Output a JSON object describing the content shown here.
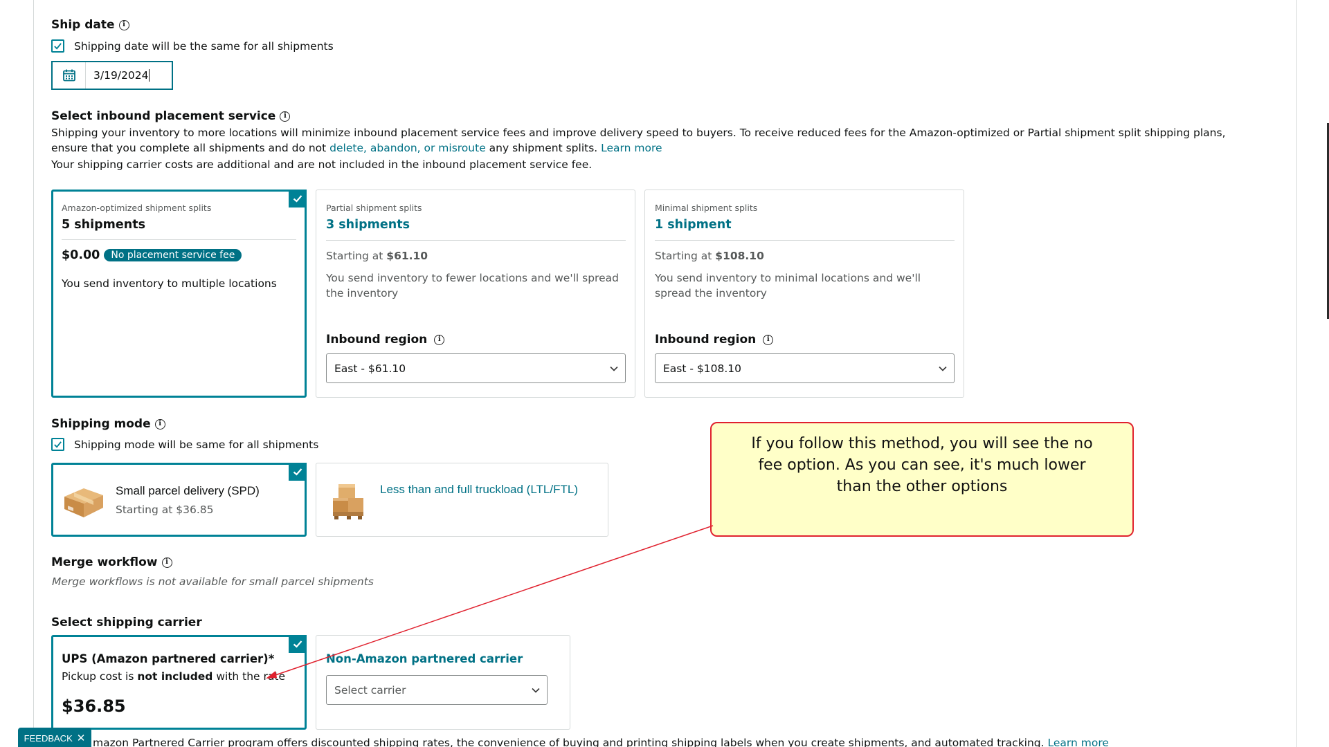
{
  "ship_date": {
    "title": "Ship date",
    "same_date_checkbox": "Shipping date will be the same for all shipments",
    "date_value": "3/19/2024"
  },
  "placement": {
    "title": "Select inbound placement service",
    "description_part1": "Shipping your inventory to more locations will minimize inbound placement service fees and improve delivery speed to buyers. To receive reduced fees for the Amazon-optimized or Partial shipment split shipping plans, ensure that you complete all shipments and do not",
    "description_link": "delete, abandon, or misroute",
    "description_part2": "any shipment splits.",
    "learn_more": "Learn more",
    "carrier_cost_note": "Your shipping carrier costs are additional and are not included in the inbound placement service fee.",
    "options": [
      {
        "label": "Amazon-optimized shipment splits",
        "shipments": "5 shipments",
        "price": "$0.00",
        "badge": "No placement service fee",
        "description": "You send inventory to multiple locations"
      },
      {
        "label": "Partial shipment splits",
        "shipments": "3 shipments",
        "starting_prefix": "Starting at",
        "price": "$61.10",
        "description": "You send inventory to fewer locations and we'll spread the inventory",
        "region_label": "Inbound region",
        "region_value": "East - $61.10"
      },
      {
        "label": "Minimal shipment splits",
        "shipments": "1 shipment",
        "starting_prefix": "Starting at",
        "price": "$108.10",
        "description": "You send inventory to minimal locations and we'll spread the inventory",
        "region_label": "Inbound region",
        "region_value": "East - $108.10"
      }
    ]
  },
  "shipping_mode": {
    "title": "Shipping mode",
    "same_mode_checkbox": "Shipping mode will be same for all shipments",
    "options": [
      {
        "name": "Small parcel delivery (SPD)",
        "starting": "Starting at $36.85"
      },
      {
        "name": "Less than and full truckload (LTL/FTL)"
      }
    ]
  },
  "merge_workflow": {
    "title": "Merge workflow",
    "note": "Merge workflows is not available for small parcel shipments"
  },
  "carrier": {
    "title": "Select shipping carrier",
    "ups": {
      "name": "UPS (Amazon partnered carrier)*",
      "pickup_prefix": "Pickup cost is",
      "pickup_bold": "not included",
      "pickup_suffix": "with the rate",
      "price": "$36.85"
    },
    "non_amazon": {
      "name": "Non-Amazon partnered carrier",
      "select_placeholder": "Select carrier"
    },
    "footer_text": "mazon Partnered Carrier program offers discounted shipping rates, the convenience of buying and printing shipping labels when you create shipments, and automated tracking.",
    "footer_link": "Learn more"
  },
  "callout": {
    "text": "If you follow this method, you will see the no fee option. As you can see, it's much lower than the other options"
  },
  "feedback": {
    "label": "FEEDBACK"
  },
  "colors": {
    "teal": "#008296",
    "link": "#007185",
    "callout_fill": "#ffffc8",
    "callout_border": "#e0212e"
  }
}
